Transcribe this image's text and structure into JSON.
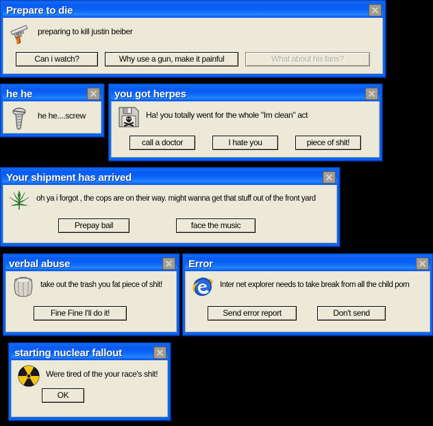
{
  "desktop": {
    "background_color": "#000000"
  },
  "theme": {
    "titlebar_blue": "#0a5ff5",
    "client_background": "#ece9d8",
    "button_face": "#ece9d8",
    "title_text_color": "#ffffff",
    "disabled_text_color": "#aca899",
    "close_button_color": "#a09c94"
  },
  "dialogs": [
    {
      "id": "prepare",
      "title": "Prepare to die",
      "icon": "gun-icon",
      "message": "preparing to kill justin beiber",
      "close_label": "×",
      "buttons": [
        {
          "label": "Can i watch?",
          "disabled": false
        },
        {
          "label": "Why use a gun, make it painful",
          "disabled": false
        },
        {
          "label": "What about his fans?",
          "disabled": true
        }
      ]
    },
    {
      "id": "hehe",
      "title": "he he",
      "icon": "screw-icon",
      "message": "he he....screw",
      "close_label": "×",
      "buttons": []
    },
    {
      "id": "herpes",
      "title": "you got herpes",
      "icon": "floppy-skull-icon",
      "message": "Ha! you totally went for the whole \"Im clean\" act",
      "close_label": "×",
      "buttons": [
        {
          "label": "call a doctor",
          "disabled": false
        },
        {
          "label": "I hate you",
          "disabled": false
        },
        {
          "label": "piece of shit!",
          "disabled": false
        }
      ]
    },
    {
      "id": "shipment",
      "title": "Your shipment has arrived",
      "icon": "cannabis-leaf-icon",
      "message": "oh ya i forgot , the cops are on their way. might wanna get that stuff out of the front yard",
      "close_label": "×",
      "buttons": [
        {
          "label": "Prepay bail",
          "disabled": false
        },
        {
          "label": "face the music",
          "disabled": false
        }
      ]
    },
    {
      "id": "verbal",
      "title": "verbal abuse",
      "icon": "trash-can-icon",
      "message": "take out the trash you fat piece of shit!",
      "close_label": "×",
      "buttons": [
        {
          "label": "Fine Fine I'll do it!",
          "disabled": false
        }
      ]
    },
    {
      "id": "error",
      "title": "Error",
      "icon": "internet-explorer-icon",
      "message": "Inter net explorer needs to take break from all the child porn",
      "close_label": "×",
      "buttons": [
        {
          "label": "Send error report",
          "disabled": false
        },
        {
          "label": "Don't send",
          "disabled": false
        }
      ]
    },
    {
      "id": "nuclear",
      "title": "starting nuclear fallout",
      "icon": "radiation-icon",
      "message": "Were tired of the your race's shit!",
      "close_label": "×",
      "buttons": [
        {
          "label": "OK",
          "disabled": false
        }
      ]
    }
  ]
}
